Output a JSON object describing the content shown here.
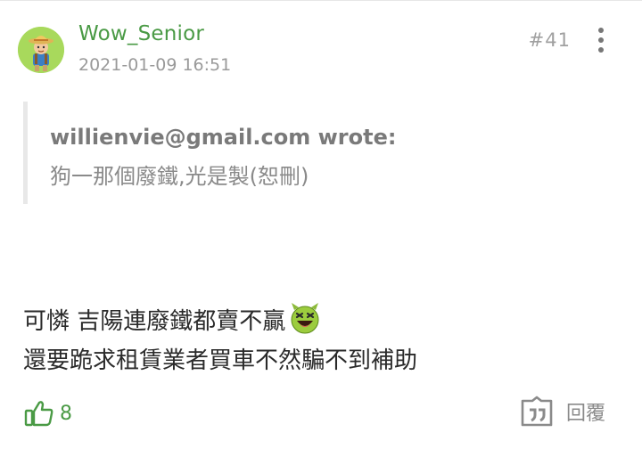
{
  "post": {
    "username": "Wow_Senior",
    "timestamp": "2021-01-09 16:51",
    "floor": "#41",
    "avatar_icon": "hiker-avatar-icon",
    "colors": {
      "username": "#4a9a45",
      "accent": "#4a9a45",
      "muted": "#9a9a9a"
    }
  },
  "quote": {
    "author_line": "willienvie@gmail.com wrote:",
    "text": "狗一那個廢鐵,光是製(恕刪)"
  },
  "content": {
    "line1": "可憐 吉陽連廢鐵都賣不贏",
    "line2": "還要跪求租賃業者買車不然騙不到補助",
    "emoji_icon": "devil-laugh-emoji-icon"
  },
  "actions": {
    "like_count": "8",
    "like_icon": "thumbs-up-icon",
    "reply_label": "回覆",
    "reply_icon": "quote-reply-icon",
    "more_icon": "more-vertical-icon"
  }
}
